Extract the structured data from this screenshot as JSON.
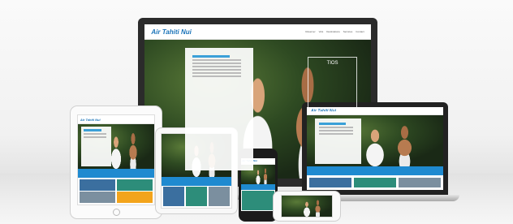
{
  "brand": {
    "logo_text": "Air Tahiti Nui"
  },
  "monitor": {
    "nav": [
      "Réserver",
      "Vols",
      "Destinations",
      "Services",
      "Contact"
    ],
    "promo_text": "TIOS"
  },
  "colors": {
    "accent": "#1f8ad0",
    "brand": "#1a73b8",
    "orange": "#f3a41c"
  }
}
